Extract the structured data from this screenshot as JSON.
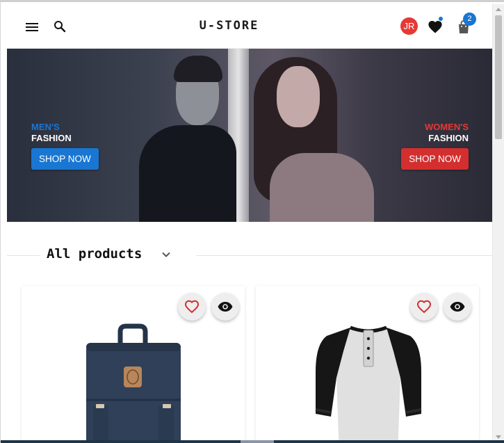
{
  "header": {
    "brand": "U-STORE",
    "avatar_initials": "JR",
    "cart_count": "2",
    "icons": [
      "menu-icon",
      "search-icon",
      "heart-icon",
      "shopping-bag-icon"
    ]
  },
  "hero": {
    "left": {
      "subtitle": "MEN'S",
      "title": "FASHION",
      "button": "SHOP NOW"
    },
    "right": {
      "subtitle": "WOMEN'S",
      "title": "FASHION",
      "button": "SHOP NOW"
    }
  },
  "products_section": {
    "title": "All products",
    "icons": [
      "chevron-down-icon"
    ]
  },
  "products": [
    {
      "image": "backpack",
      "actions": [
        "heart-outline-icon",
        "eye-icon"
      ]
    },
    {
      "image": "raglan-henley-shirt",
      "actions": [
        "heart-outline-icon",
        "eye-icon"
      ]
    }
  ],
  "colors": {
    "mens_accent": "#1976d2",
    "womens_accent": "#d32f2f",
    "badge": "#1976d2",
    "avatar": "#e53935"
  }
}
